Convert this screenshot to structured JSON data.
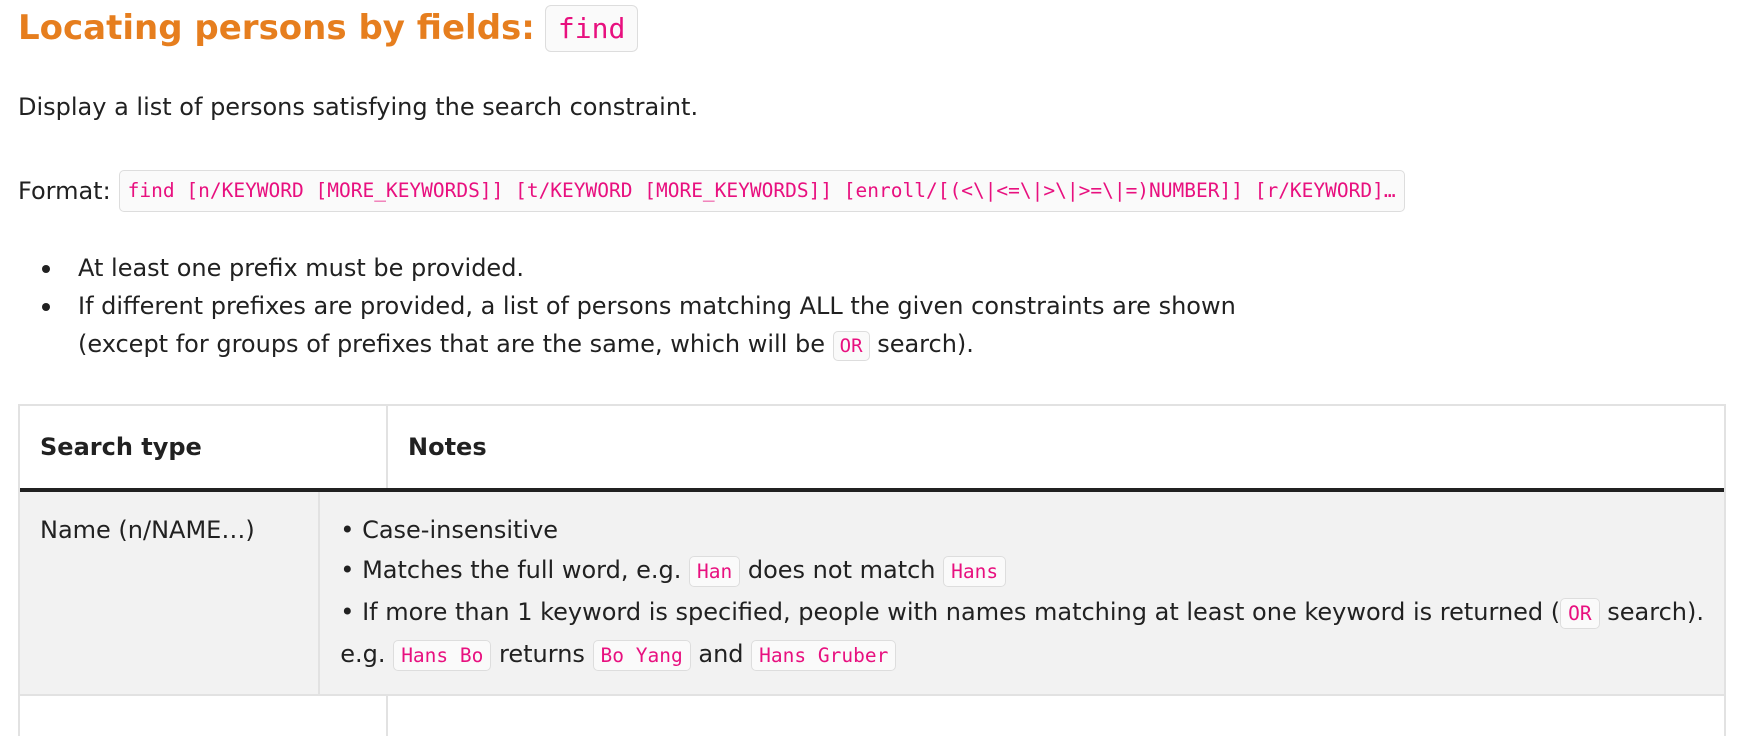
{
  "heading": {
    "title": "Locating persons by fields:",
    "command": "find"
  },
  "description": "Display a list of persons satisfying the search constraint.",
  "format": {
    "label": "Format:",
    "code": "find [n/KEYWORD [MORE_KEYWORDS]] [t/KEYWORD [MORE_KEYWORDS]] [enroll/[(<\\|<=\\|>\\|>=\\|=)NUMBER]] [r/KEYWORD]…"
  },
  "bullets": [
    {
      "text": "At least one prefix must be provided."
    },
    {
      "line1": "If different prefixes are provided, a list of persons matching ALL the given constraints are shown",
      "line2_before": "(except for groups of prefixes that are the same, which will be",
      "line2_code": "OR",
      "line2_after": "search)."
    }
  ],
  "table": {
    "headers": [
      "Search type",
      "Notes"
    ],
    "rows": [
      {
        "type": "Name (n/NAME…)",
        "note1": "• Case-insensitive",
        "note2_before": "• Matches the full word, e.g.",
        "note2_code1": "Han",
        "note2_mid": "does not match",
        "note2_code2": "Hans",
        "note3_before": "• If more than 1 keyword is specified, people with names matching at least one keyword is returned (",
        "note3_code": "OR",
        "note3_after": "search).",
        "note4_before": "e.g.",
        "note4_code1": "Hans Bo",
        "note4_mid1": "returns",
        "note4_code2": "Bo Yang",
        "note4_mid2": "and",
        "note4_code3": "Hans Gruber"
      }
    ]
  }
}
